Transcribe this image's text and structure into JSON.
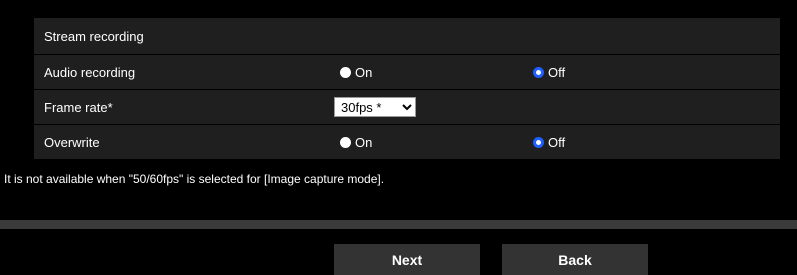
{
  "section": {
    "title": "Stream recording"
  },
  "rows": {
    "audio": {
      "label": "Audio recording",
      "on_label": "On",
      "off_label": "Off",
      "selected": "Off"
    },
    "framerate": {
      "label": "Frame rate*",
      "value": "30fps *",
      "options": [
        "30fps *"
      ]
    },
    "overwrite": {
      "label": "Overwrite",
      "on_label": "On",
      "off_label": "Off",
      "selected": "Off"
    }
  },
  "note": "It is not available when \"50/60fps\" is selected for [Image capture mode].",
  "buttons": {
    "next": "Next",
    "back": "Back"
  },
  "colors": {
    "background": "#000000",
    "row": "#1f1f1f",
    "radio_selected": "#1f5fff",
    "button": "#333333"
  }
}
